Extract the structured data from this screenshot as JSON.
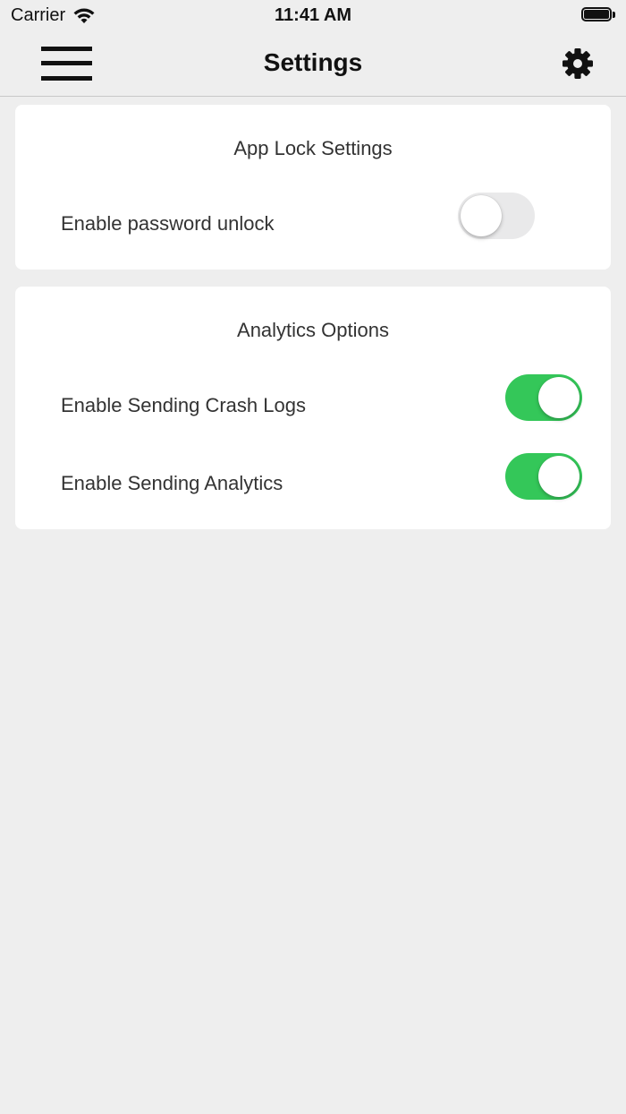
{
  "status_bar": {
    "carrier": "Carrier",
    "time": "11:41 AM"
  },
  "nav": {
    "title": "Settings",
    "menu_icon": "hamburger-menu-icon",
    "settings_icon": "gear-icon"
  },
  "app_lock": {
    "title": "App Lock Settings",
    "password_unlock": {
      "label": "Enable password unlock",
      "enabled": false
    }
  },
  "analytics": {
    "title": "Analytics Options",
    "crash_logs": {
      "label": "Enable Sending Crash Logs",
      "enabled": true
    },
    "send_analytics": {
      "label": "Enable Sending Analytics",
      "enabled": true
    }
  },
  "colors": {
    "toggle_on": "#34c759",
    "toggle_off": "#e9e9ea",
    "background": "#eeeeee"
  }
}
